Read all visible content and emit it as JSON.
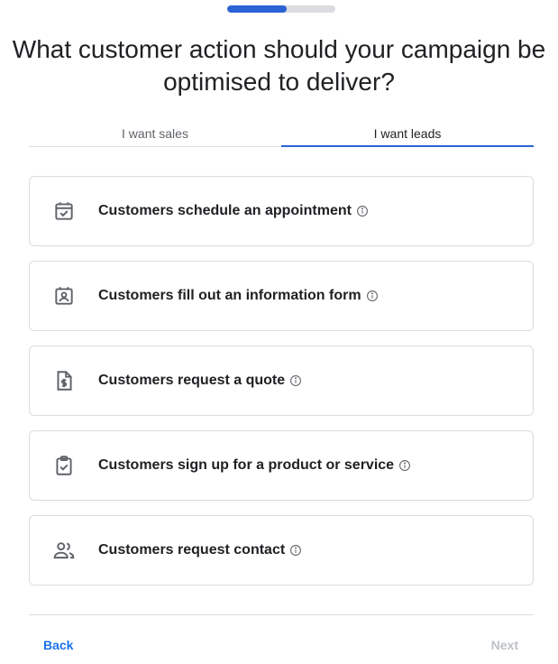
{
  "progress": {
    "fraction": 0.55
  },
  "title": "What customer action should your campaign be optimised to deliver?",
  "tabs": [
    {
      "label": "I want sales",
      "active": false
    },
    {
      "label": "I want leads",
      "active": true
    }
  ],
  "options": [
    {
      "label": "Customers schedule an appointment",
      "icon": "calendar-check-icon"
    },
    {
      "label": "Customers fill out an information form",
      "icon": "contact-form-icon"
    },
    {
      "label": "Customers request a quote",
      "icon": "document-dollar-icon"
    },
    {
      "label": "Customers sign up for a product or service",
      "icon": "clipboard-check-icon"
    },
    {
      "label": "Customers request contact",
      "icon": "people-icon"
    }
  ],
  "footer": {
    "back_label": "Back",
    "next_label": "Next"
  },
  "colors": {
    "accent": "#2c63d4",
    "link": "#1a73e8",
    "disabled": "#bdc1c6",
    "border": "#dadce0"
  }
}
